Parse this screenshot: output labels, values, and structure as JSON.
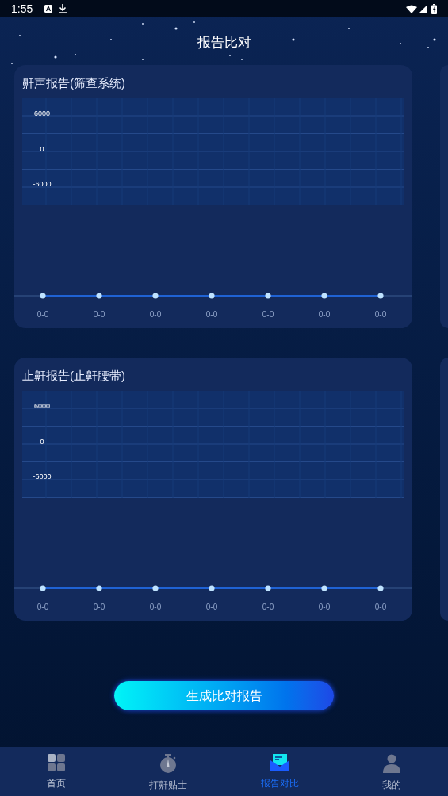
{
  "status_bar": {
    "time": "1:55"
  },
  "title": "报告比对",
  "cards": [
    {
      "title": "鼾声报告(筛查系统)",
      "y_ticks": [
        "6000",
        "0",
        "-6000"
      ],
      "x_labels": [
        "0-0",
        "0-0",
        "0-0",
        "0-0",
        "0-0",
        "0-0",
        "0-0"
      ]
    },
    {
      "title": "止鼾报告(止鼾腰带)",
      "y_ticks": [
        "6000",
        "0",
        "-6000"
      ],
      "x_labels": [
        "0-0",
        "0-0",
        "0-0",
        "0-0",
        "0-0",
        "0-0",
        "0-0"
      ]
    }
  ],
  "button": "生成比对报告",
  "nav": [
    {
      "label": "首页",
      "kind": "grid",
      "selected": false
    },
    {
      "label": "打鼾贴士",
      "kind": "timer",
      "selected": false
    },
    {
      "label": "报告对比",
      "kind": "mail",
      "selected": true
    },
    {
      "label": "我的",
      "kind": "person",
      "selected": false
    }
  ]
}
